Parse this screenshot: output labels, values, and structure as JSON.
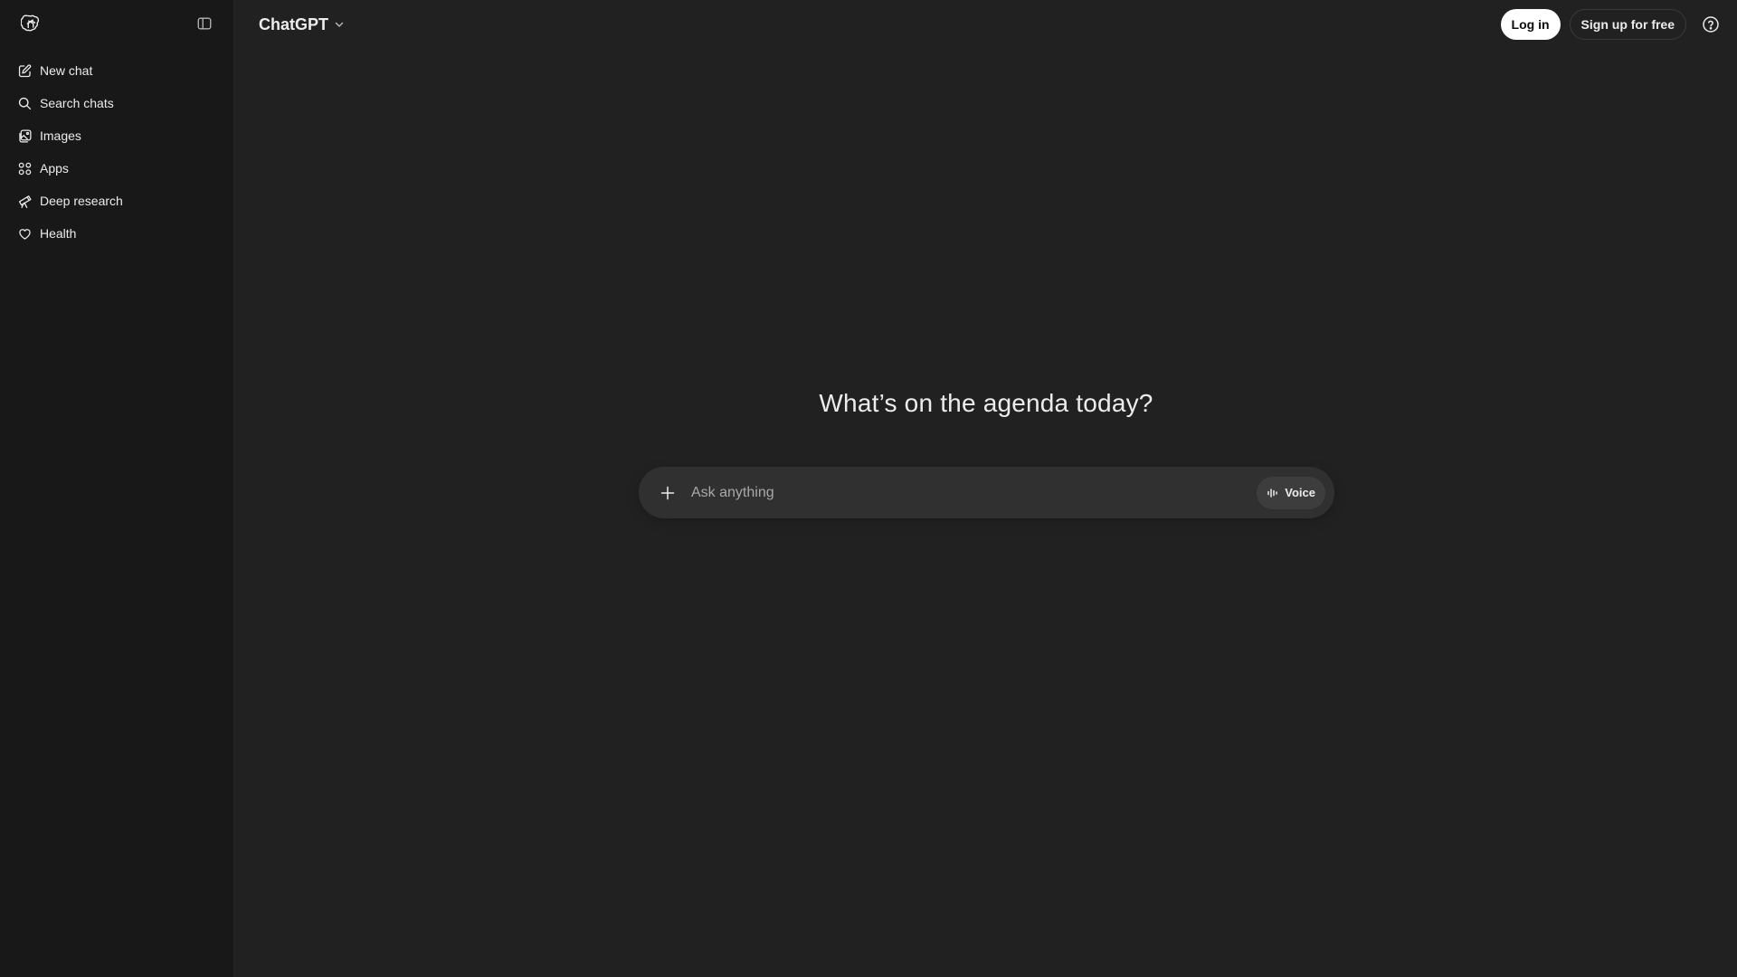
{
  "sidebar": {
    "logo_icon": "openai-logo-icon",
    "toggle_icon": "sidebar-toggle-icon",
    "items": [
      {
        "label": "New chat",
        "icon": "edit-icon"
      },
      {
        "label": "Search chats",
        "icon": "search-icon"
      },
      {
        "label": "Images",
        "icon": "images-icon"
      },
      {
        "label": "Apps",
        "icon": "apps-grid-icon"
      },
      {
        "label": "Deep research",
        "icon": "telescope-icon"
      },
      {
        "label": "Health",
        "icon": "heart-icon"
      }
    ]
  },
  "header": {
    "model_name": "ChatGPT",
    "login_label": "Log in",
    "signup_label": "Sign up for free",
    "help_icon": "help-circle-icon"
  },
  "main": {
    "headline": "What’s on the agenda today?",
    "composer": {
      "placeholder": "Ask anything",
      "voice_label": "Voice"
    }
  },
  "colors": {
    "background": "#212121",
    "sidebar": "#181818",
    "composer": "#303030",
    "login_button": "#ffffff"
  }
}
